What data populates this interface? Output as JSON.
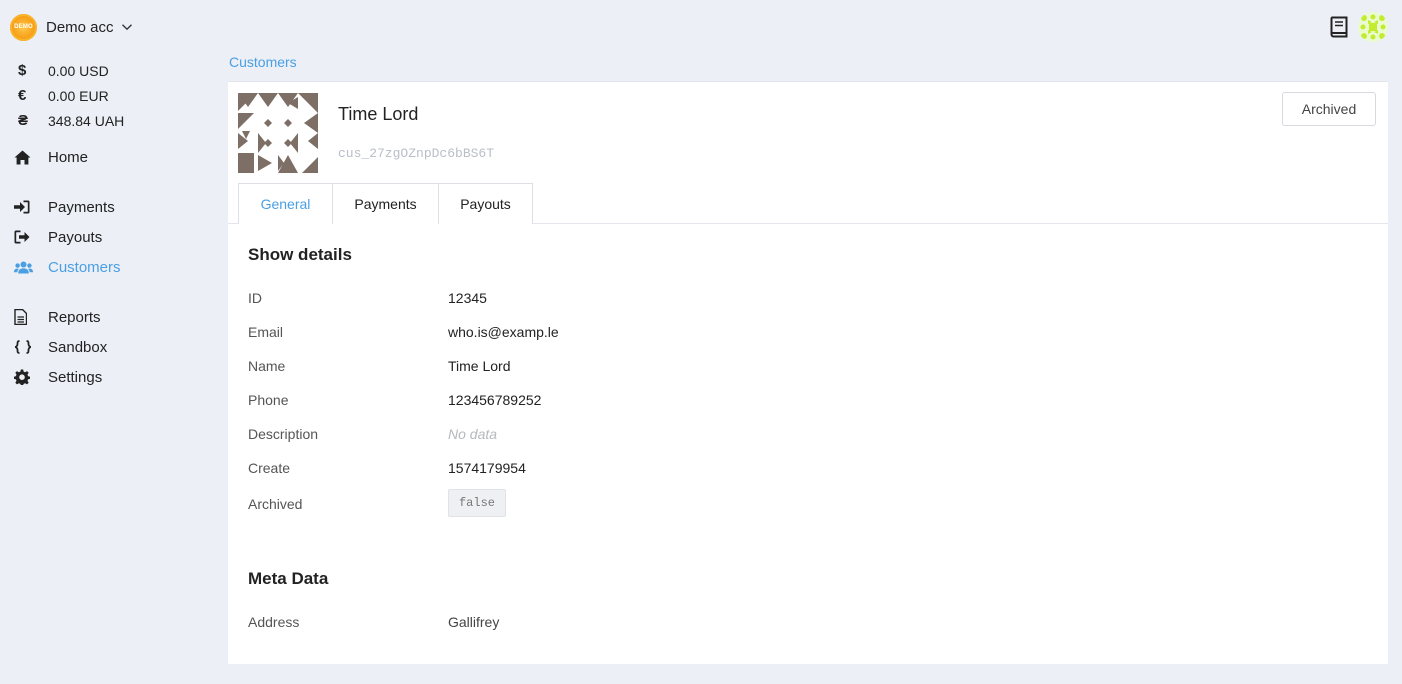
{
  "account": {
    "name": "Demo acc",
    "logo_text": "DEMO"
  },
  "balances": [
    {
      "symbol": "$",
      "value": "0.00 USD"
    },
    {
      "symbol": "€",
      "value": "0.00 EUR"
    },
    {
      "symbol": "₴",
      "value": "348.84 UAH"
    }
  ],
  "nav": {
    "home": "Home",
    "payments": "Payments",
    "payouts": "Payouts",
    "customers": "Customers",
    "reports": "Reports",
    "sandbox": "Sandbox",
    "settings": "Settings"
  },
  "breadcrumb": "Customers",
  "customer": {
    "name": "Time Lord",
    "id": "cus_27zgOZnpDc6bBS6T",
    "archived_button": "Archived"
  },
  "tabs": [
    "General",
    "Payments",
    "Payouts"
  ],
  "details": {
    "title": "Show details",
    "fields": [
      {
        "label": "ID",
        "value": "12345"
      },
      {
        "label": "Email",
        "value": "who.is@examp.le"
      },
      {
        "label": "Name",
        "value": "Time Lord"
      },
      {
        "label": "Phone",
        "value": "123456789252"
      },
      {
        "label": "Description",
        "value": "No data"
      },
      {
        "label": "Create",
        "value": "1574179954"
      },
      {
        "label": "Archived",
        "value": "false"
      }
    ]
  },
  "meta": {
    "title": "Meta Data",
    "fields": [
      {
        "label": "Address",
        "value": "Gallifrey"
      }
    ]
  },
  "colors": {
    "accent": "#4a9fe3",
    "background": "#eceff6",
    "identicon": "#7d6e66"
  }
}
